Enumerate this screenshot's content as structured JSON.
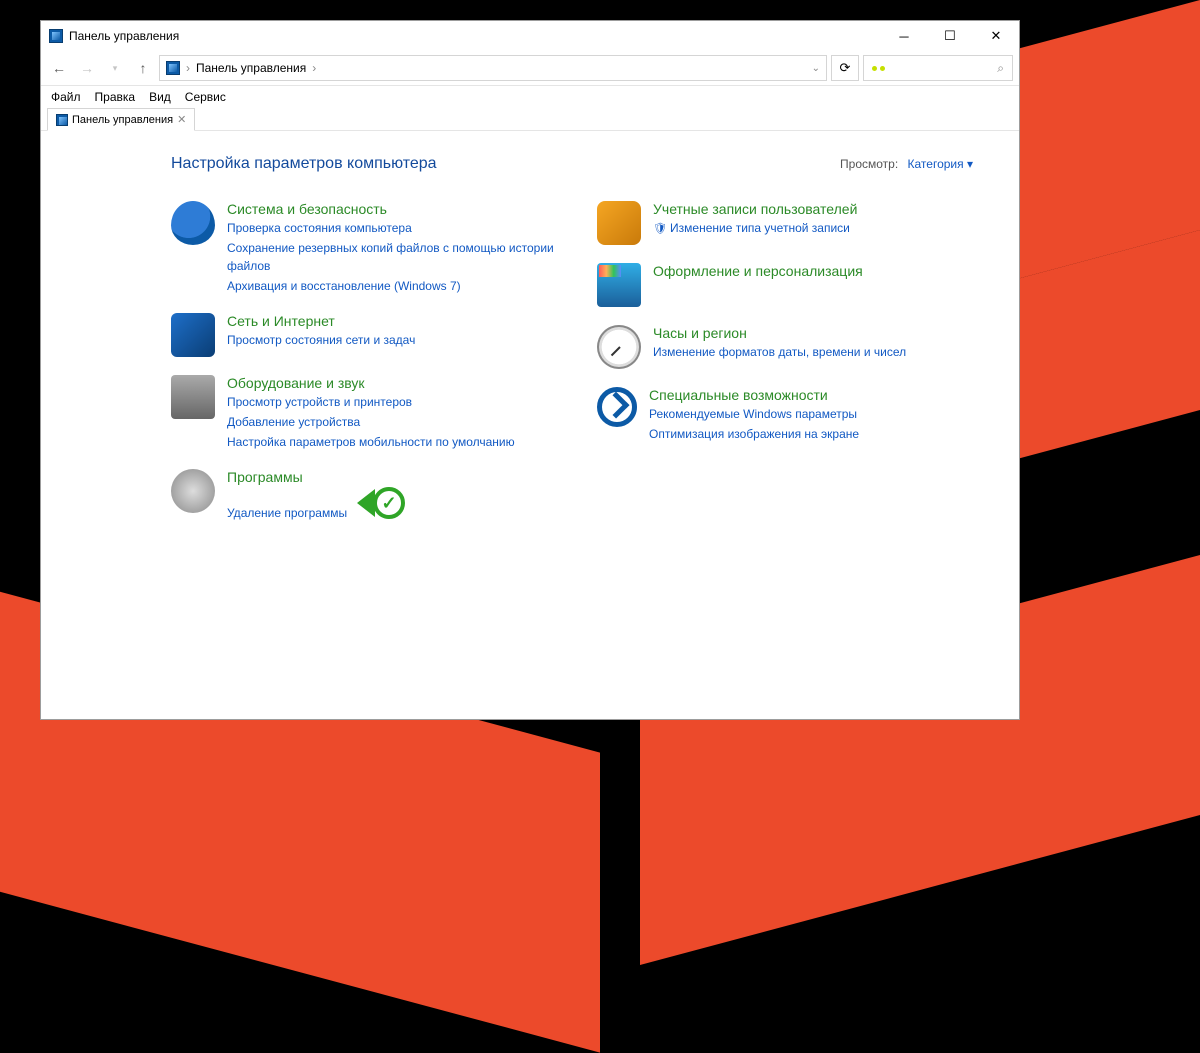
{
  "window": {
    "title": "Панель управления"
  },
  "breadcrumb": {
    "root": "Панель управления"
  },
  "menubar": [
    "Файл",
    "Правка",
    "Вид",
    "Сервис"
  ],
  "tab": {
    "label": "Панель управления"
  },
  "page": {
    "heading": "Настройка параметров компьютера",
    "viewby_label": "Просмотр:",
    "viewby_value": "Категория"
  },
  "left": [
    {
      "icon": "shield-icon",
      "title": "Система и безопасность",
      "links": [
        "Проверка состояния компьютера",
        "Сохранение резервных копий файлов с помощью истории файлов",
        "Архивация и восстановление (Windows 7)"
      ]
    },
    {
      "icon": "network-icon",
      "title": "Сеть и Интернет",
      "links": [
        "Просмотр состояния сети и задач"
      ]
    },
    {
      "icon": "hardware-icon",
      "title": "Оборудование и звук",
      "links": [
        "Просмотр устройств и принтеров",
        "Добавление устройства",
        "Настройка параметров мобильности по умолчанию"
      ]
    },
    {
      "icon": "programs-icon",
      "title": "Программы",
      "links": [
        "Удаление программы"
      ],
      "callout": true
    }
  ],
  "right": [
    {
      "icon": "users-icon",
      "title": "Учетные записи пользователей",
      "links": [
        "Изменение типа учетной записи"
      ],
      "shield": true
    },
    {
      "icon": "appearance-icon",
      "title": "Оформление и персонализация",
      "links": []
    },
    {
      "icon": "clock-icon",
      "title": "Часы и регион",
      "links": [
        "Изменение форматов даты, времени и чисел"
      ]
    },
    {
      "icon": "access-icon",
      "title": "Специальные возможности",
      "links": [
        "Рекомендуемые Windows параметры",
        "Оптимизация изображения на экране"
      ]
    }
  ]
}
